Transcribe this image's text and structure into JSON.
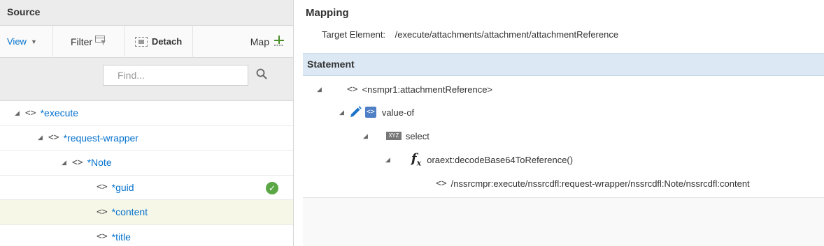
{
  "source": {
    "title": "Source",
    "toolbar": {
      "view_label": "View",
      "filter_label": "Filter",
      "detach_label": "Detach",
      "map_label": "Map"
    },
    "find_placeholder": "Find...",
    "tree": [
      {
        "label": "*execute",
        "level": 0,
        "expanded": true
      },
      {
        "label": "*request-wrapper",
        "level": 1,
        "expanded": true
      },
      {
        "label": "*Note",
        "level": 2,
        "expanded": true
      },
      {
        "label": "*guid",
        "level": 3,
        "mapped": true
      },
      {
        "label": "*content",
        "level": 3,
        "selected": true
      },
      {
        "label": "*title",
        "level": 3
      }
    ],
    "colors": {
      "link": "#0572ce",
      "mapped_check": "#5ba745",
      "selected_row": "#f7f7e7"
    }
  },
  "mapping": {
    "title": "Mapping",
    "target_label": "Target Element:",
    "target_path": "/execute/attachments/attachment/attachmentReference",
    "statement_header": "Statement",
    "statements": [
      {
        "icon": "tag-icon",
        "text": "<nsmpr1:attachmentReference>"
      },
      {
        "icon": "xsl-value-of-icon",
        "text": "value-of"
      },
      {
        "icon": "xyz-select-icon",
        "text": "select"
      },
      {
        "icon": "function-fx-icon",
        "text": "oraext:decodeBase64ToReference()"
      },
      {
        "icon": "tag-icon",
        "text": "/nssrcmpr:execute/nssrcdfl:request-wrapper/nssrcdfl:Note/nssrcdfl:content"
      }
    ],
    "colors": {
      "statement_header_bg": "#dce9f4",
      "xsl_icon": "#4f7fc4",
      "pencil": "#1a73c8"
    }
  }
}
